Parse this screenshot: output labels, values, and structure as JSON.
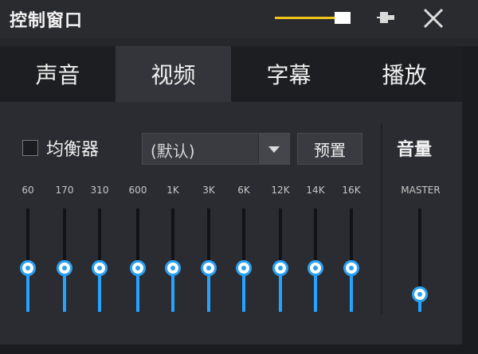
{
  "window": {
    "title": "控制窗口",
    "opacity_level": 1.0
  },
  "tabs": [
    {
      "label": "声音",
      "active": false
    },
    {
      "label": "视频",
      "active": true
    },
    {
      "label": "字幕",
      "active": false
    },
    {
      "label": "播放",
      "active": false
    }
  ],
  "equalizer": {
    "checkbox_label": "均衡器",
    "checked": false,
    "preset_value": "(默认)",
    "preset_button_label": "预置",
    "bands": [
      {
        "label": "60",
        "level": 0.42
      },
      {
        "label": "170",
        "level": 0.42
      },
      {
        "label": "310",
        "level": 0.42
      },
      {
        "label": "600",
        "level": 0.42
      },
      {
        "label": "1K",
        "level": 0.42
      },
      {
        "label": "3K",
        "level": 0.42
      },
      {
        "label": "6K",
        "level": 0.42
      },
      {
        "label": "12K",
        "level": 0.42
      },
      {
        "label": "14K",
        "level": 0.42
      },
      {
        "label": "16K",
        "level": 0.42
      }
    ]
  },
  "volume": {
    "title": "音量",
    "master_label": "MASTER",
    "master_level": 0.17
  },
  "icons": {
    "pin": "pin-icon",
    "close": "close-icon",
    "dropdown": "chevron-down-icon"
  },
  "colors": {
    "accent_blue": "#26a3ff",
    "opacity_yellow": "#f0c419",
    "background": "#26272b"
  }
}
